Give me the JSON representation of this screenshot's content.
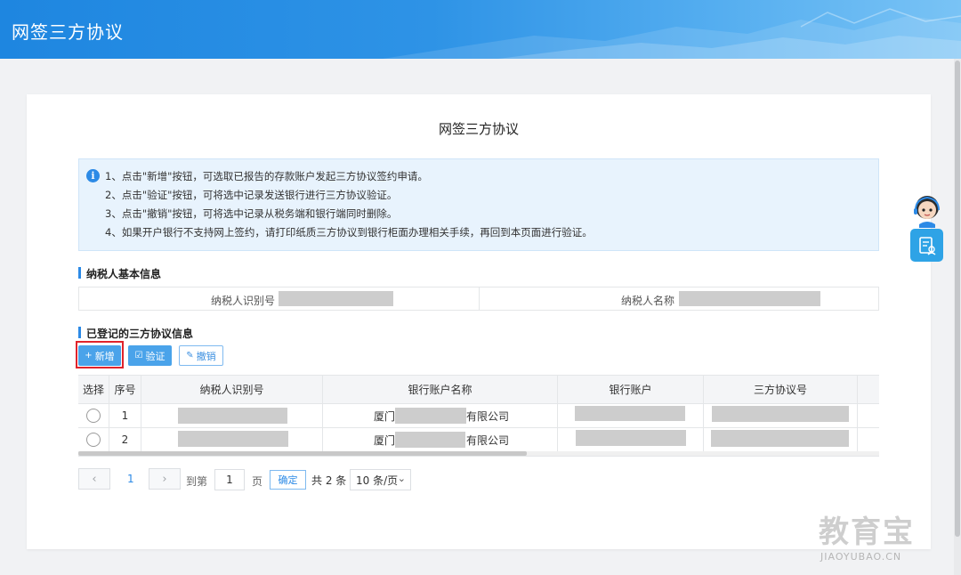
{
  "header": {
    "title": "网签三方协议"
  },
  "page": {
    "title": "网签三方协议"
  },
  "notice": {
    "lines": [
      "1、点击\"新增\"按钮，可选取已报告的存款账户发起三方协议签约申请。",
      "2、点击\"验证\"按钮，可将选中记录发送银行进行三方协议验证。",
      "3、点击\"撤销\"按钮，可将选中记录从税务端和银行端同时删除。",
      "4、如果开户银行不支持网上签约，请打印纸质三方协议到银行柜面办理相关手续，再回到本页面进行验证。"
    ]
  },
  "taxpayer_section": {
    "title": "纳税人基本信息",
    "id_label": "纳税人识别号",
    "name_label": "纳税人名称"
  },
  "agreement_section": {
    "title": "已登记的三方协议信息",
    "buttons": {
      "add": "新增",
      "verify": "验证",
      "revoke": "撤销"
    },
    "columns": [
      "选择",
      "序号",
      "纳税人识别号",
      "银行账户名称",
      "银行账户",
      "三方协议号"
    ],
    "rows": [
      {
        "index": "1",
        "bank_prefix": "厦门",
        "bank_suffix": "有限公司"
      },
      {
        "index": "2",
        "bank_prefix": "厦门",
        "bank_suffix": "有限公司"
      }
    ]
  },
  "pagination": {
    "prev": "‹",
    "next": "›",
    "current_page": "1",
    "goto_label": "到第",
    "page_input": "1",
    "page_unit": "页",
    "confirm": "确定",
    "total": "共 2 条",
    "page_size": "10 条/页"
  },
  "watermark": {
    "cn": "教育宝",
    "en": "JIAOYUBAO.CN"
  },
  "icons": {
    "info": "info-icon",
    "add": "plus-icon",
    "verify": "checkbox-icon",
    "revoke": "pencil-icon",
    "side": "document-person-icon"
  },
  "colors": {
    "primary": "#2c8ae6",
    "header": "#1e86e0",
    "highlight": "#e0232b"
  }
}
